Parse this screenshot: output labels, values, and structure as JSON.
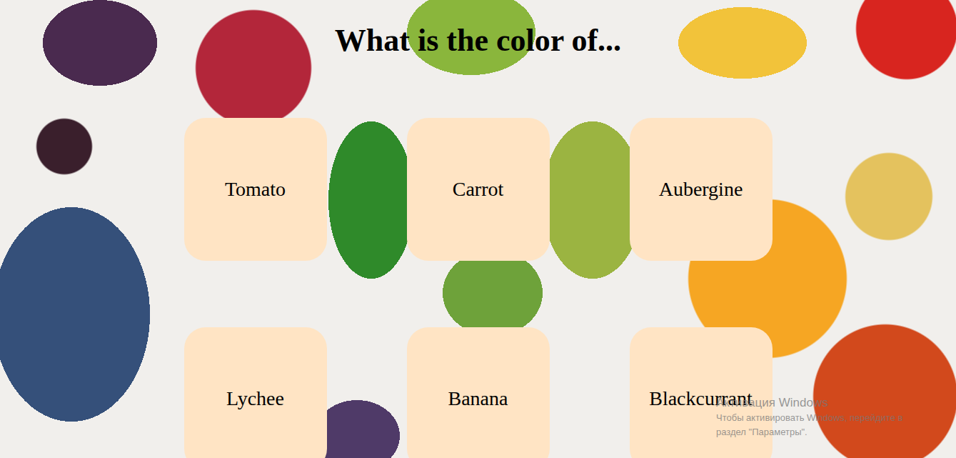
{
  "title": "What is the color of...",
  "items": [
    {
      "label": "Tomato"
    },
    {
      "label": "Carrot"
    },
    {
      "label": "Aubergine"
    },
    {
      "label": "Lychee"
    },
    {
      "label": "Banana"
    },
    {
      "label": "Blackcurrant"
    }
  ],
  "watermark": {
    "title": "Активация Windows",
    "lines": [
      "Чтобы активировать Windows, перейдите в",
      "раздел \"Параметры\"."
    ]
  }
}
